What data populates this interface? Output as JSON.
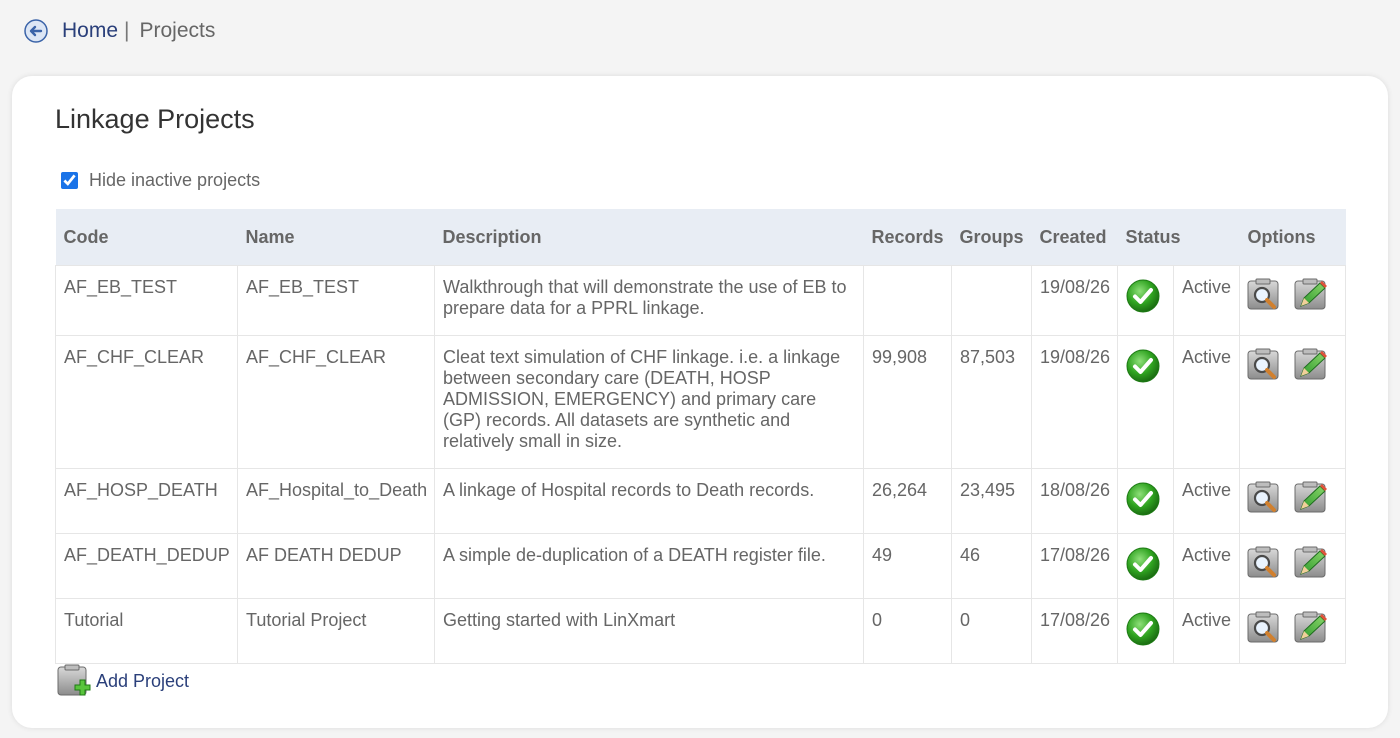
{
  "breadcrumb": {
    "home": "Home",
    "separator": "|",
    "current": "Projects"
  },
  "page": {
    "title": "Linkage Projects"
  },
  "filter": {
    "label": "Hide inactive projects",
    "checked": true
  },
  "table": {
    "headers": {
      "code": "Code",
      "name": "Name",
      "description": "Description",
      "records": "Records",
      "groups": "Groups",
      "created": "Created",
      "status": "Status",
      "options": "Options"
    },
    "rows": [
      {
        "code": "AF_EB_TEST",
        "name": "AF_EB_TEST",
        "description": "Walkthrough that will demonstrate the use of EB to prepare data for a PPRL linkage.",
        "records": "",
        "groups": "",
        "created": "19/08/26",
        "status": "Active"
      },
      {
        "code": "AF_CHF_CLEAR",
        "name": "AF_CHF_CLEAR",
        "description": "Cleat text simulation of CHF linkage. i.e. a linkage between secondary care (DEATH, HOSP ADMISSION, EMERGENCY) and primary care (GP) records. All datasets are synthetic and relatively small in size.",
        "records": "99,908",
        "groups": "87,503",
        "created": "19/08/26",
        "status": "Active"
      },
      {
        "code": "AF_HOSP_DEATH",
        "name": "AF_Hospital_to_Death",
        "description": "A linkage of Hospital records to Death records.",
        "records": "26,264",
        "groups": "23,495",
        "created": "18/08/26",
        "status": "Active"
      },
      {
        "code": "AF_DEATH_DEDUP",
        "name": "AF DEATH DEDUP",
        "description": "A simple de-duplication of a DEATH register file.",
        "records": "49",
        "groups": "46",
        "created": "17/08/26",
        "status": "Active"
      },
      {
        "code": "Tutorial",
        "name": "Tutorial Project",
        "description": "Getting started with LinXmart",
        "records": "0",
        "groups": "0",
        "created": "17/08/26",
        "status": "Active"
      }
    ]
  },
  "actions": {
    "add_project": "Add Project"
  },
  "icons": {
    "back": "back-arrow-icon",
    "status": "check-icon",
    "view": "magnifier-icon",
    "edit": "pencil-edit-icon",
    "add": "add-folder-icon"
  },
  "colors": {
    "link": "#2a3f7a",
    "header_bg": "#e8edf4",
    "check": "#2fa320"
  }
}
